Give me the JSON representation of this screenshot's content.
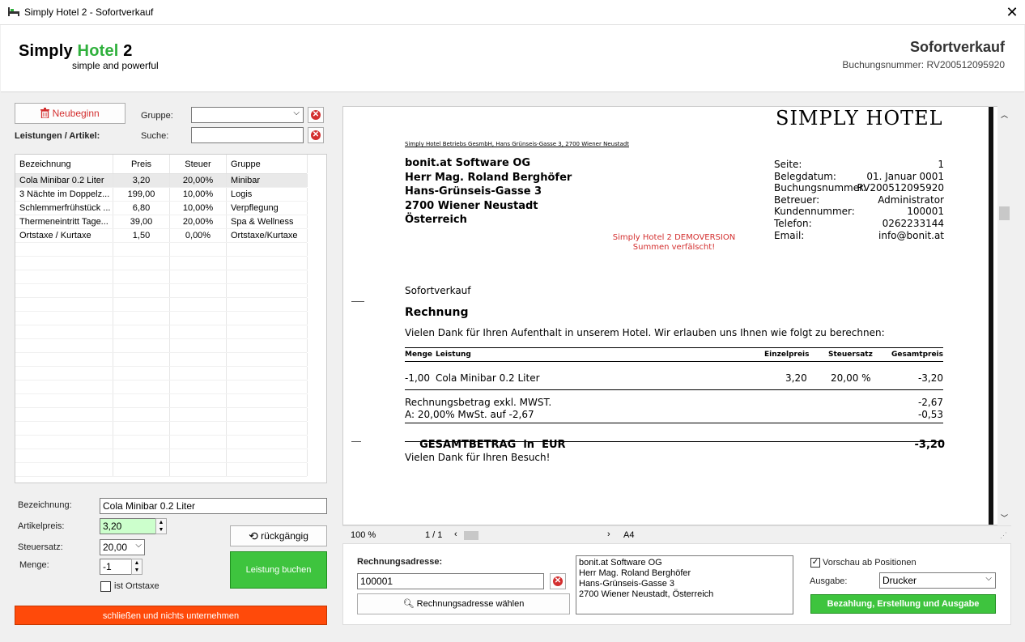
{
  "window": {
    "title": "Simply Hotel 2 - Sofortverkauf",
    "close": "✕"
  },
  "header": {
    "logo_a": "Simply ",
    "logo_b": "Hotel",
    "logo_c": " 2",
    "tagline": "simple and powerful",
    "title": "Sofortverkauf",
    "booking_label": "Buchungsnummer: RV200512095920"
  },
  "left": {
    "restart_button": "Neubeginn",
    "group_label": "Gruppe:",
    "group_value": "",
    "search_label": "Suche:",
    "search_value": "",
    "items_label": "Leistungen / Artikel:",
    "columns": [
      "Bezeichnung",
      "Preis",
      "Steuer",
      "Gruppe"
    ],
    "rows": [
      [
        "Cola Minibar 0.2 Liter",
        "3,20",
        "20,00%",
        "Minibar"
      ],
      [
        "3 Nächte im Doppelz...",
        "199,00",
        "10,00%",
        "Logis"
      ],
      [
        "Schlemmerfrühstück ...",
        "6,80",
        "10,00%",
        "Verpflegung"
      ],
      [
        "Thermeneintritt Tage...",
        "39,00",
        "20,00%",
        "Spa & Wellness"
      ],
      [
        "Ortstaxe / Kurtaxe",
        "1,50",
        "0,00%",
        "Ortstaxe/Kurtaxe"
      ]
    ],
    "form": {
      "name_label": "Bezeichnung:",
      "name_value": "Cola Minibar 0.2 Liter",
      "price_label": "Artikelpreis:",
      "price_value": "3,20",
      "tax_label": "Steuersatz:",
      "tax_value": "20,00",
      "qty_label": "Menge:",
      "qty_value": "-1",
      "ortstaxe_label": "ist Ortstaxe",
      "undo_button": "rückgängig",
      "book_button": "Leistung buchen"
    },
    "close_button": "schließen und nichts unternehmen"
  },
  "invoice": {
    "brand": "SIMPLY HOTEL",
    "sender_line": "Simply Hotel Betriebs GesmbH, Hans Grünseis-Gasse 3, 2700 Wiener Neustadt",
    "address": [
      "bonit.at Software OG",
      "Herr Mag. Roland Bergh­öfer",
      "Hans-Grünseis-Gasse 3",
      "2700 Wiener Neustadt",
      "Österreich"
    ],
    "meta": [
      [
        "Seite:",
        "1"
      ],
      [
        "Belegdatum:",
        "01. Januar 0001"
      ],
      [
        "Buchungsnummer:",
        "RV200512095920"
      ],
      [
        "Betreuer:",
        "Administrator"
      ],
      [
        "Kundennummer:",
        "100001"
      ],
      [
        "Telefon:",
        "0262233144"
      ],
      [
        "Email:",
        "info@bonit.at"
      ]
    ],
    "demo_line1": "Simply Hotel 2 DEMOVERSION",
    "demo_line2": "Summen verfälscht!",
    "doc_type": "Sofortverkauf",
    "heading": "Rechnung",
    "intro": "Vielen Dank für Ihren Aufenthalt in unserem Hotel. Wir erlauben uns Ihnen wie folgt zu berechnen:",
    "table_headers": [
      "Menge",
      "Leistung",
      "Einzelpreis",
      "Steuersatz",
      "Gesamtpreis"
    ],
    "line": [
      "-1,00",
      "Cola Minibar 0.2 Liter",
      "3,20",
      "20,00 %",
      "-3,20"
    ],
    "net_label": "Rechnungsbetrag exkl. MWST.",
    "net_value": "-2,67",
    "vat_label": "A: 20,00% MwSt. auf -2,67",
    "vat_value": "-0,53",
    "total_label": "GESAMTBETRAG  in  EUR",
    "total_value": "-3,20",
    "thanks": "Vielen Dank für Ihren Besuch!"
  },
  "status": {
    "zoom": "100 %",
    "pages": "1 / 1",
    "paper": "A4"
  },
  "bottom": {
    "address_label": "Rechnungsadresse:",
    "address_id": "100001",
    "choose_button": "Rechnungsadresse wählen",
    "address_text": [
      "bonit.at Software OG",
      "Herr Mag. Roland Berghöfer",
      "Hans-Grünseis-Gasse 3",
      "2700 Wiener Neustadt, Österreich"
    ],
    "preview_check": "Vorschau ab Positionen",
    "output_label": "Ausgabe:",
    "output_value": "Drucker",
    "pay_button": "Bezahlung, Erstellung und Ausgabe"
  }
}
